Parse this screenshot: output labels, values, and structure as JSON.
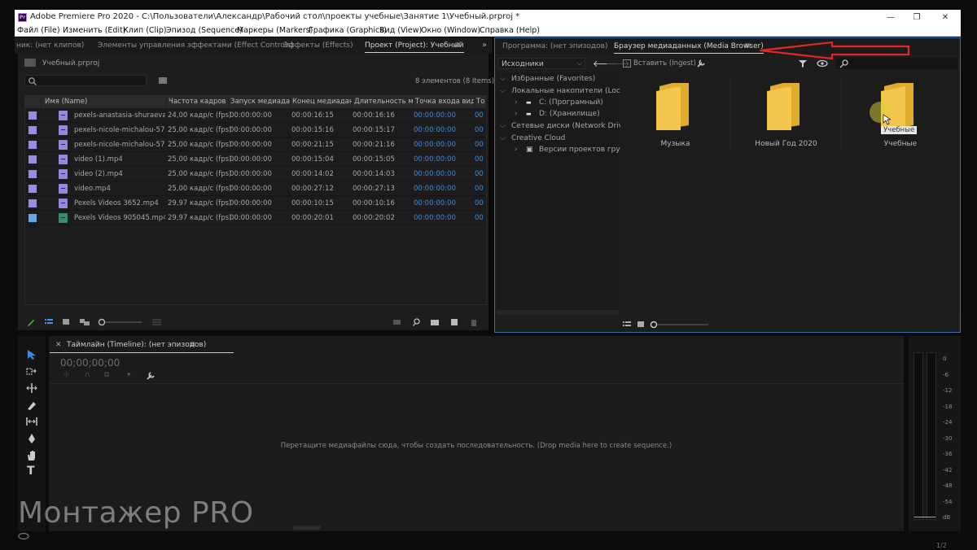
{
  "window": {
    "title": "Adobe Premiere Pro 2020 - C:\\Пользователи\\Александр\\Рабочий стол\\проекты учебные\\Занятие 1\\Учебный.prproj *",
    "logo_text": "Pr"
  },
  "menu": [
    "Файл (File)",
    "Изменить (Edit)",
    "Клип (Clip)",
    "Эпизод (Sequence)",
    "Маркеры (Markers)",
    "Графика (Graphics)",
    "Вид (View)",
    "Окно (Window)",
    "Справка (Help)"
  ],
  "left_tabs": {
    "source": "ник: (нет клипов)",
    "effect_controls": "Элементы управления эффектами (Effect Controls)",
    "effects": "Эффекты (Effects)",
    "project": "Проект (Project): Учебный",
    "menu_icon": "≡",
    "overflow": "»"
  },
  "project": {
    "file_name": "Учебный.prproj",
    "search_placeholder": "",
    "items_count": "8 элементов (8 Items)",
    "columns": [
      "Имя (Name)",
      "Частота кадров (F",
      "Запуск медиадан",
      "Конец медиаданн",
      "Длительность ме",
      "Точка входа виде",
      "То"
    ],
    "rows": [
      {
        "name": "pexels-anastasia-shuraeva-",
        "fps": "24,00 кадр/с (fps)",
        "start": "00:00:00:00",
        "end": "00:00:16:15",
        "duration": "00:00:16:16",
        "in": "00:00:00:00",
        "out": "00"
      },
      {
        "name": "pexels-nicole-michalou-573",
        "fps": "25,00 кадр/с (fps)",
        "start": "00:00:00:00",
        "end": "00:00:15:16",
        "duration": "00:00:15:17",
        "in": "00:00:00:00",
        "out": "00"
      },
      {
        "name": "pexels-nicole-michalou-573",
        "fps": "25,00 кадр/с (fps)",
        "start": "00:00:00:00",
        "end": "00:00:21:15",
        "duration": "00:00:21:16",
        "in": "00:00:00:00",
        "out": "00"
      },
      {
        "name": "video (1).mp4",
        "fps": "25,00 кадр/с (fps)",
        "start": "00:00:00:00",
        "end": "00:00:15:04",
        "duration": "00:00:15:05",
        "in": "00:00:00:00",
        "out": "00"
      },
      {
        "name": "video (2).mp4",
        "fps": "25,00 кадр/с (fps)",
        "start": "00:00:00:00",
        "end": "00:00:14:02",
        "duration": "00:00:14:03",
        "in": "00:00:00:00",
        "out": "00"
      },
      {
        "name": "video.mp4",
        "fps": "25,00 кадр/с (fps)",
        "start": "00:00:00:00",
        "end": "00:00:27:12",
        "duration": "00:00:27:13",
        "in": "00:00:00:00",
        "out": "00"
      },
      {
        "name": "Pexels Videos 3652.mp4",
        "fps": "29,97 кадр/с (fps)",
        "start": "00:00:00:00",
        "end": "00:00:10:15",
        "duration": "00:00:10:16",
        "in": "00:00:00:00",
        "out": "00"
      },
      {
        "name": "Pexels Videos 905045.mp4",
        "fps": "29,97 кадр/с (fps)",
        "start": "00:00:00:00",
        "end": "00:00:20:01",
        "duration": "00:00:20:02",
        "in": "00:00:00:00",
        "out": "00"
      }
    ]
  },
  "right_tabs": {
    "program": "Программа: (нет эпизодов)",
    "media_browser": "Браузер медиаданных (Media Browser)",
    "menu_icon": "≡"
  },
  "media_browser": {
    "source_select": "Исходники",
    "ingest_label": "Вставить (Ingest)",
    "tree": {
      "favorites": "Избранные (Favorites)",
      "local_drives": "Локальные накопители (Local Driv",
      "drive_c": "C: (Програмный)",
      "drive_d": "D: (Хранилище)",
      "network": "Сетевые диски (Network Drives)",
      "creative_cloud": "Creative Cloud",
      "versions": "Версии проектов группы"
    },
    "folders": [
      "Музыка",
      "Новый Год 2020",
      "Учебные"
    ],
    "tooltip": "Учебные"
  },
  "timeline": {
    "title": "Таймлайн (Timeline): (нет эпизодов)",
    "timecode": "00;00;00;00",
    "drop_hint": "Перетащите медиафайлы сюда, чтобы создать последовательность. (Drop media here to create sequence.)"
  },
  "meter": {
    "ticks": [
      "0",
      "-6",
      "-12",
      "-18",
      "-24",
      "-30",
      "-36",
      "-42",
      "-48",
      "-54",
      "dB"
    ]
  },
  "watermark": "Монтажер PRO",
  "footer": "1/2",
  "colors": {
    "accent_blue": "#3f8bdb",
    "clip_label": "#9c8ce0",
    "folder_yellow": "#f0c64b",
    "annotation_red": "#e0282b"
  }
}
